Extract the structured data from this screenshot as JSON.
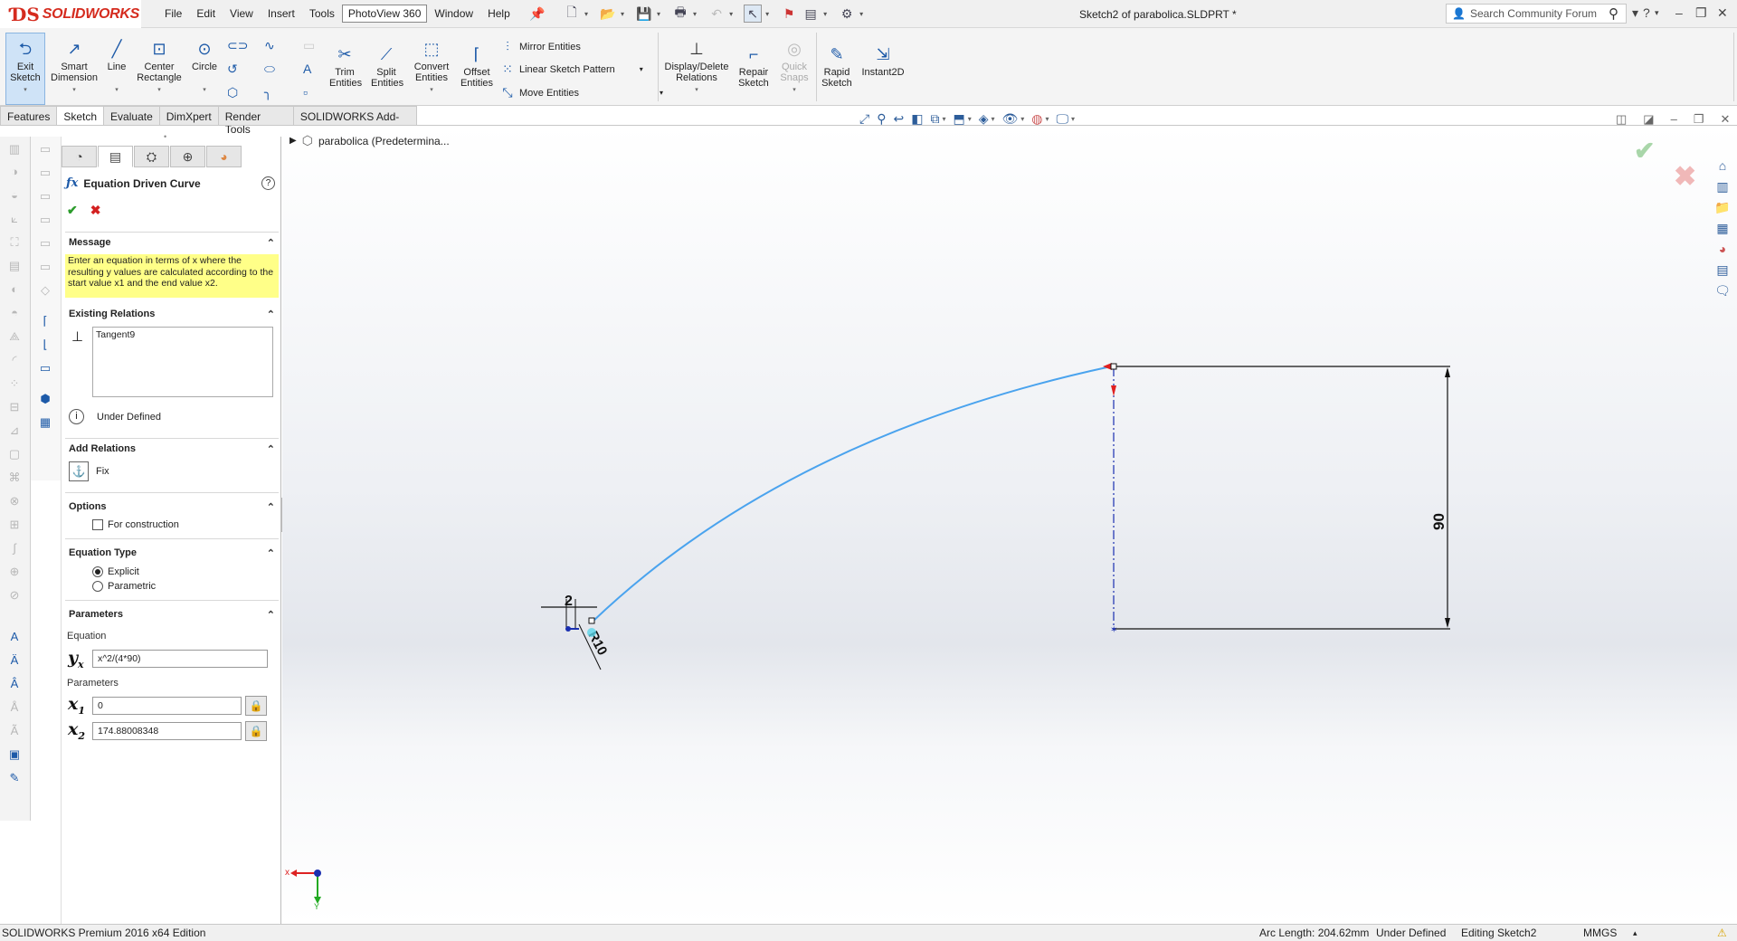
{
  "app": {
    "brand": "SOLIDWORKS",
    "document_title": "Sketch2 of parabolica.SLDPRT *",
    "menu": [
      "File",
      "Edit",
      "View",
      "Insert",
      "Tools",
      "PhotoView 360",
      "Window",
      "Help"
    ],
    "search_placeholder": "Search Community Forum"
  },
  "ribbon": {
    "exit_sketch": "Exit Sketch",
    "smart_dimension": "Smart Dimension",
    "line": "Line",
    "center_rectangle": "Center Rectangle",
    "circle": "Circle",
    "trim_entities": "Trim Entities",
    "split_entities": "Split Entities",
    "convert_entities": "Convert Entities",
    "offset_entities": "Offset Entities",
    "mirror_entities": "Mirror Entities",
    "linear_sketch_pattern": "Linear Sketch Pattern",
    "move_entities": "Move Entities",
    "display_delete_relations": "Display/Delete Relations",
    "repair_sketch": "Repair Sketch",
    "quick_snaps": "Quick Snaps",
    "rapid_sketch": "Rapid Sketch",
    "instant2d": "Instant2D"
  },
  "tabs": [
    "Features",
    "Sketch",
    "Evaluate",
    "DimXpert",
    "Render Tools",
    "SOLIDWORKS Add-Ins"
  ],
  "active_tab": "Sketch",
  "property_manager": {
    "title": "Equation Driven Curve",
    "message_header": "Message",
    "message_text": "Enter an equation in terms of x where the resulting y values are calculated according to the start value x1 and the end value x2.",
    "existing_relations_header": "Existing Relations",
    "existing_relations": [
      "Tangent9"
    ],
    "status": "Under Defined",
    "add_relations_header": "Add Relations",
    "add_relation_fix": "Fix",
    "options_header": "Options",
    "for_construction": "For construction",
    "equation_type_header": "Equation Type",
    "explicit": "Explicit",
    "parametric": "Parametric",
    "parameters_header": "Parameters",
    "equation_label": "Equation",
    "equation_value": "x^2/(4*90)",
    "parameters_label": "Parameters",
    "x1_value": "0",
    "x2_value": "174.88008348"
  },
  "graphics": {
    "tree_item": "parabolica  (Predetermina...",
    "dim_small": "2",
    "dim_radius": "R10",
    "dim_height": "90",
    "axis_x": "x",
    "axis_y": "Y",
    "curve_color": "#4aa3ee",
    "dimension_color": "#111111",
    "construction_color": "#1a2fb0"
  },
  "status_bar": {
    "edition": "SOLIDWORKS Premium 2016 x64 Edition",
    "arc_length": "Arc Length: 204.62mm",
    "definition": "Under Defined",
    "editing": "Editing Sketch2",
    "units": "MMGS"
  }
}
